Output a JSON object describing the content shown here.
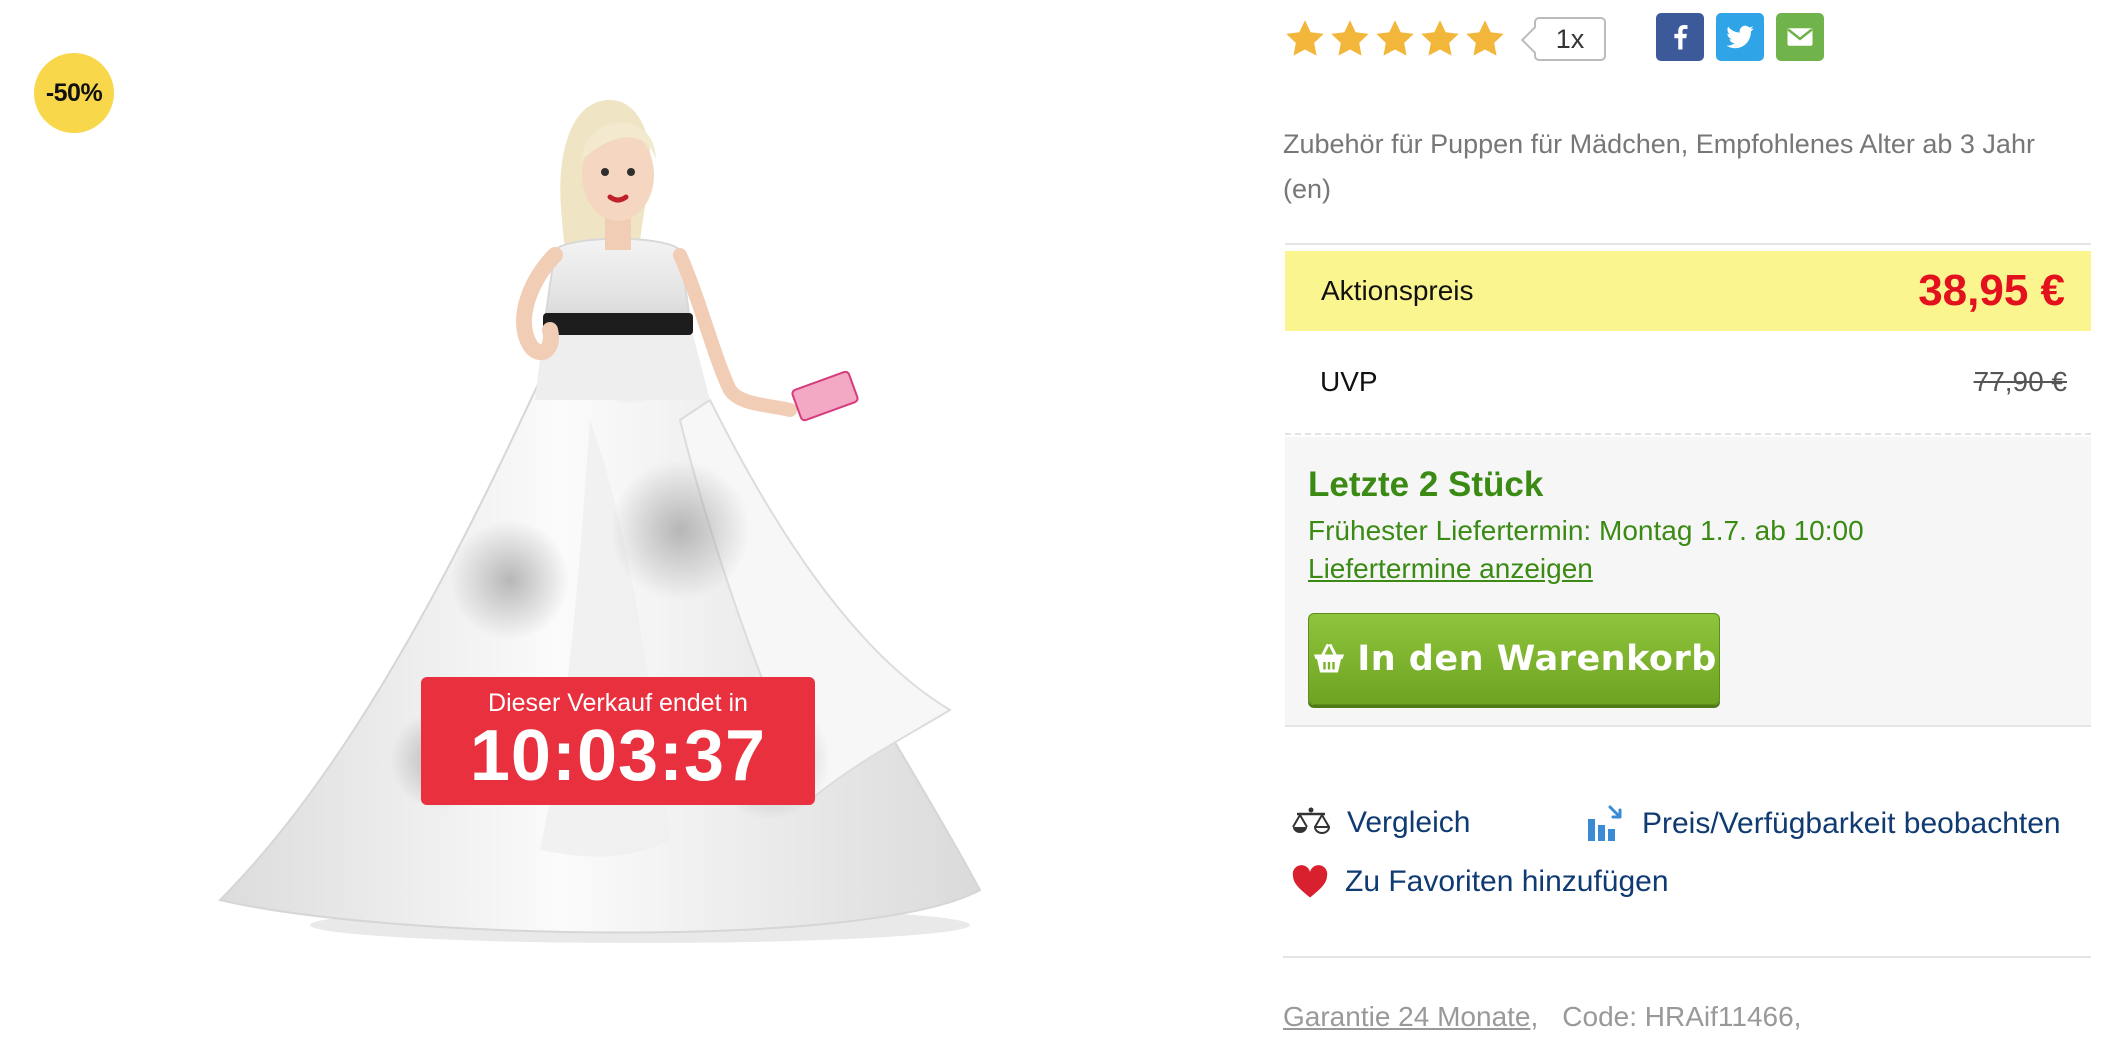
{
  "colors": {
    "discount_badge": "#f8d74a",
    "sale_timer": "#e8303f",
    "action_price_background": "#faf58e",
    "action_price_text": "#e3101d",
    "stock_green": "#3a8a14",
    "cart_button": "#7bb22c",
    "link_blue": "#0f3a72",
    "star": "#f2b63a"
  },
  "product_image": {
    "discount_badge": "-50%",
    "image_icon": "barbie-doll-product-photo",
    "sale_timer": {
      "label": "Dieser Verkauf endet in",
      "time": "10:03:37"
    }
  },
  "rating": {
    "stars": 5,
    "max_stars": 5,
    "icon": "star-icon",
    "review_count": "1x"
  },
  "share": [
    {
      "name": "facebook",
      "icon": "facebook-icon"
    },
    {
      "name": "twitter",
      "icon": "twitter-icon"
    },
    {
      "name": "email",
      "icon": "email-icon"
    }
  ],
  "description": "Zubehör für Puppen für Mädchen, Empfohlenes Alter ab 3 Jahr (en)",
  "pricing": {
    "action_label": "Aktionspreis",
    "action_price": "38,95 €",
    "uvp_label": "UVP",
    "uvp_price": "77,90 €"
  },
  "availability": {
    "stock": "Letzte 2 Stück",
    "earliest_delivery": "Frühester Liefertermin: Montag 1.7. ab 10:00",
    "delivery_link": "Liefertermine anzeigen",
    "cart_button": "In den Warenkorb",
    "cart_icon": "basket-icon"
  },
  "actions": {
    "compare": "Vergleich",
    "compare_icon": "scale-icon",
    "watch": "Preis/Verfügbarkeit beobachten",
    "watch_icon": "bar-chart-icon",
    "favorites": "Zu Favoriten hinzufügen",
    "favorites_icon": "heart-icon"
  },
  "meta": {
    "warranty": "Garantie 24 Monate",
    "code": "Code: HRAif11466,"
  }
}
